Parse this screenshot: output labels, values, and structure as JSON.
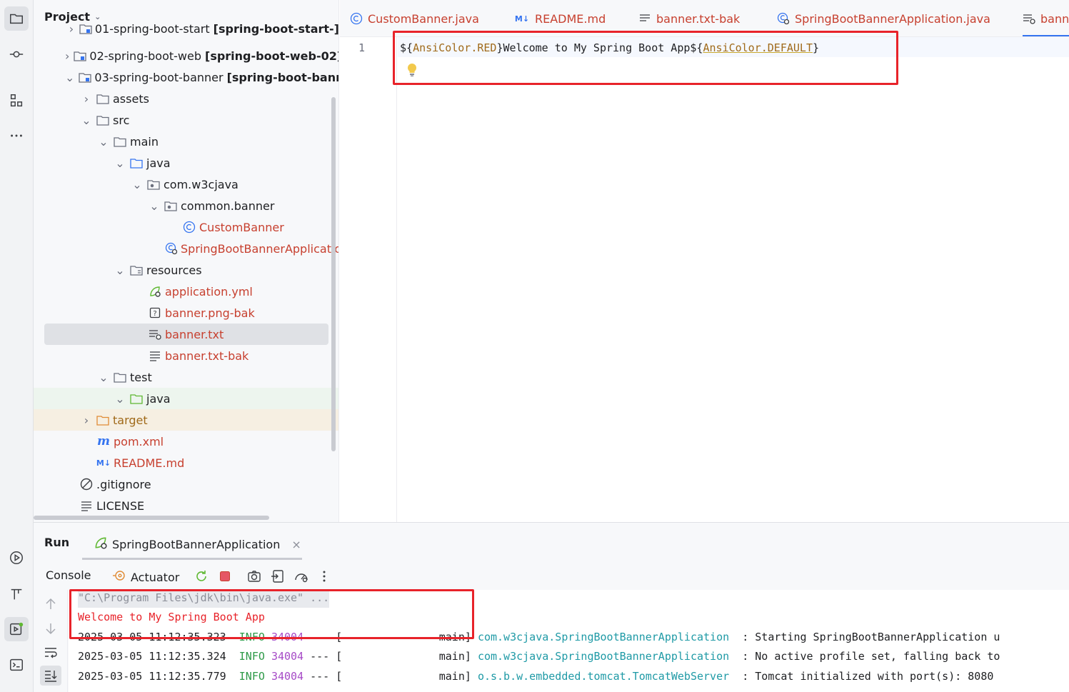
{
  "project": {
    "title": "Project",
    "items": [
      {
        "label": "01-spring-boot-start",
        "module": "[spring-boot-start-]"
      },
      {
        "label": "02-spring-boot-web",
        "module": "[spring-boot-web-02]"
      },
      {
        "label": "03-spring-boot-banner",
        "module": "[spring-boot-banner]"
      },
      {
        "label": "assets"
      },
      {
        "label": "src"
      },
      {
        "label": "main"
      },
      {
        "label": "java"
      },
      {
        "label": "com.w3cjava"
      },
      {
        "label": "common.banner"
      },
      {
        "label": "CustomBanner"
      },
      {
        "label": "SpringBootBannerApplicatio"
      },
      {
        "label": "resources"
      },
      {
        "label": "application.yml"
      },
      {
        "label": "banner.png-bak"
      },
      {
        "label": "banner.txt"
      },
      {
        "label": "banner.txt-bak"
      },
      {
        "label": "test"
      },
      {
        "label": "java"
      },
      {
        "label": "target"
      },
      {
        "label": "pom.xml"
      },
      {
        "label": "README.md"
      },
      {
        "label": ".gitignore"
      },
      {
        "label": "LICENSE"
      }
    ]
  },
  "editor": {
    "tabs": [
      {
        "label": "CustomBanner.java"
      },
      {
        "label": "README.md",
        "badge": "M↓"
      },
      {
        "label": "banner.txt-bak"
      },
      {
        "label": "SpringBootBannerApplication.java"
      },
      {
        "label": "bann"
      }
    ],
    "line_number": "1",
    "code": {
      "p1": "${",
      "p2": "AnsiColor.RED",
      "p3": "}Welcome to My Spring Boot App${",
      "p4": "AnsiColor.DEFAULT",
      "p5": "}"
    }
  },
  "run": {
    "title": "Run",
    "app_tab": "SpringBootBannerApplication",
    "close": "×",
    "console_label": "Console",
    "actuator_label": "Actuator",
    "lines": {
      "cmd": "\"C:\\Program Files\\jdk\\bin\\java.exe\" ...",
      "banner": "Welcome to My Spring Boot App",
      "log": [
        {
          "ts": "2025-03-05 11:12:35.323",
          "level": "INFO",
          "pid": "34004",
          "sep": "--- [",
          "thread": "main]",
          "logger": "com.w3cjava.SpringBootBannerApplication",
          "msg": ": Starting SpringBootBannerApplication u"
        },
        {
          "ts": "2025-03-05 11:12:35.324",
          "level": "INFO",
          "pid": "34004",
          "sep": "--- [",
          "thread": "main]",
          "logger": "com.w3cjava.SpringBootBannerApplication",
          "msg": ": No active profile set, falling back to"
        },
        {
          "ts": "2025-03-05 11:12:35.779",
          "level": "INFO",
          "pid": "34004",
          "sep": "--- [",
          "thread": "main]",
          "logger": "o.s.b.w.embedded.tomcat.TomcatWebServer",
          "msg": ": Tomcat initialized with port(s): 8080"
        }
      ]
    }
  },
  "colors": {
    "highlight_box": "#e8232a",
    "accent": "#3574f0",
    "modified_file": "#c7402f"
  }
}
